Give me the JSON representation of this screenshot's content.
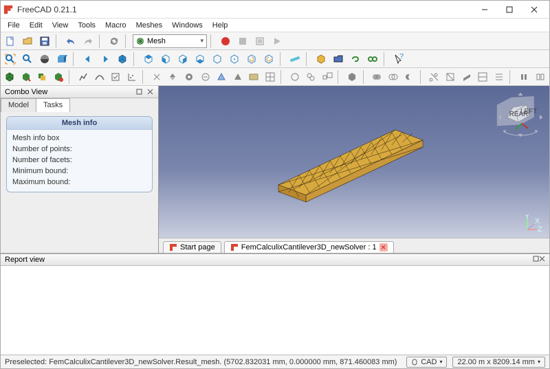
{
  "window": {
    "title": "FreeCAD 0.21.1"
  },
  "menu": [
    "File",
    "Edit",
    "View",
    "Tools",
    "Macro",
    "Meshes",
    "Windows",
    "Help"
  ],
  "workbench": {
    "label": "Mesh"
  },
  "combo": {
    "title": "Combo View",
    "tab_model": "Model",
    "tab_tasks": "Tasks"
  },
  "task": {
    "header": "Mesh info",
    "rows": [
      "Mesh info box",
      "Number of points:",
      "Number of facets:",
      "Minimum bound:",
      "Maximum bound:"
    ]
  },
  "doctabs": {
    "start": "Start page",
    "doc": "FemCalculixCantilever3D_newSolver : 1"
  },
  "report": {
    "title": "Report view"
  },
  "status": {
    "left": "Preselected: FemCalculixCantilever3D_newSolver.Result_mesh. (5702.832031 mm, 0.000000 mm, 871.460083 mm)",
    "nav": "CAD",
    "dims": "22.00 m x 8209.14 mm"
  },
  "navcube": {
    "face1": "REAR",
    "face2": "LEFT"
  }
}
